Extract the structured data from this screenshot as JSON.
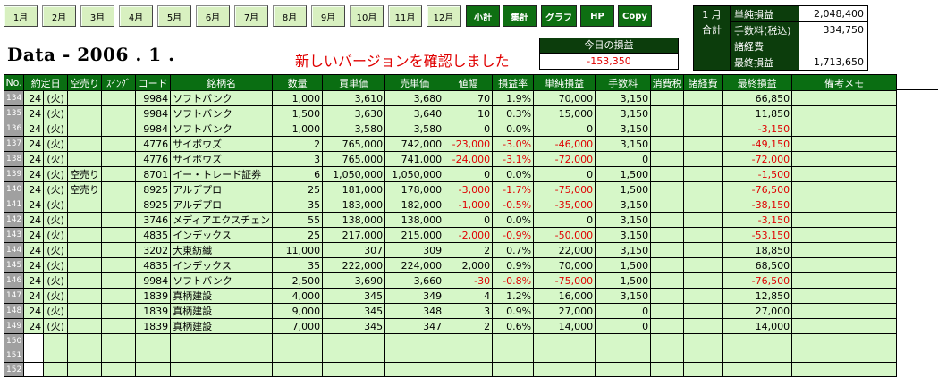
{
  "months": [
    "1月",
    "2月",
    "3月",
    "4月",
    "5月",
    "6月",
    "7月",
    "8月",
    "9月",
    "10月",
    "11月",
    "12月"
  ],
  "actions": [
    "小計",
    "集計",
    "グラフ",
    "HP",
    "Copy"
  ],
  "title": "Data - 2006 . 1 .",
  "notice": "新しいバージョンを確認しました",
  "today": {
    "label": "今日の損益",
    "value": "-153,350"
  },
  "summary": {
    "month": "1 月",
    "total": "合計",
    "rows": [
      {
        "label": "単純損益",
        "value": "2,048,400"
      },
      {
        "label": "手数料(税込)",
        "value": "334,750"
      },
      {
        "label": "諸経費",
        "value": ""
      },
      {
        "label": "最終損益",
        "value": "1,713,650"
      }
    ]
  },
  "columns": [
    "No.",
    "約定日",
    "空売り",
    "ｽｲﾝｸﾞ",
    "コード",
    "銘柄名",
    "数量",
    "買単価",
    "売単価",
    "値幅",
    "損益率",
    "単純損益",
    "手数料",
    "消費税",
    "諸経費",
    "最終損益",
    "備考メモ"
  ],
  "rows": [
    {
      "no": "134",
      "date": "24",
      "dow": "(火)",
      "short": "",
      "code": "9984",
      "name": "ソフトバンク",
      "qty": "1,000",
      "buy": "3,610",
      "sell": "3,680",
      "diff": "70",
      "rate": "1.9%",
      "pl": "70,000",
      "fee": "3,150",
      "final": "66,850"
    },
    {
      "no": "135",
      "date": "24",
      "dow": "(火)",
      "short": "",
      "code": "9984",
      "name": "ソフトバンク",
      "qty": "1,500",
      "buy": "3,630",
      "sell": "3,640",
      "diff": "10",
      "rate": "0.3%",
      "pl": "15,000",
      "fee": "3,150",
      "final": "11,850"
    },
    {
      "no": "136",
      "date": "24",
      "dow": "(火)",
      "short": "",
      "code": "9984",
      "name": "ソフトバンク",
      "qty": "1,000",
      "buy": "3,580",
      "sell": "3,580",
      "diff": "0",
      "rate": "0.0%",
      "pl": "0",
      "fee": "3,150",
      "final": "-3,150"
    },
    {
      "no": "137",
      "date": "24",
      "dow": "(火)",
      "short": "",
      "code": "4776",
      "name": "サイボウズ",
      "qty": "2",
      "buy": "765,000",
      "sell": "742,000",
      "diff": "-23,000",
      "rate": "-3.0%",
      "pl": "-46,000",
      "fee": "3,150",
      "final": "-49,150"
    },
    {
      "no": "138",
      "date": "24",
      "dow": "(火)",
      "short": "",
      "code": "4776",
      "name": "サイボウズ",
      "qty": "3",
      "buy": "765,000",
      "sell": "741,000",
      "diff": "-24,000",
      "rate": "-3.1%",
      "pl": "-72,000",
      "fee": "0",
      "final": "-72,000"
    },
    {
      "no": "139",
      "date": "24",
      "dow": "(火)",
      "short": "空売り",
      "code": "8701",
      "name": "イー・トレード証券",
      "qty": "6",
      "buy": "1,050,000",
      "sell": "1,050,000",
      "diff": "0",
      "rate": "0.0%",
      "pl": "0",
      "fee": "1,500",
      "final": "-1,500"
    },
    {
      "no": "140",
      "date": "24",
      "dow": "(火)",
      "short": "空売り",
      "code": "8925",
      "name": "アルデプロ",
      "qty": "25",
      "buy": "181,000",
      "sell": "178,000",
      "diff": "-3,000",
      "rate": "-1.7%",
      "pl": "-75,000",
      "fee": "1,500",
      "final": "-76,500"
    },
    {
      "no": "141",
      "date": "24",
      "dow": "(火)",
      "short": "",
      "code": "8925",
      "name": "アルデプロ",
      "qty": "35",
      "buy": "183,000",
      "sell": "182,000",
      "diff": "-1,000",
      "rate": "-0.5%",
      "pl": "-35,000",
      "fee": "3,150",
      "final": "-38,150"
    },
    {
      "no": "142",
      "date": "24",
      "dow": "(火)",
      "short": "",
      "code": "3746",
      "name": "メディアエクスチェン",
      "qty": "55",
      "buy": "138,000",
      "sell": "138,000",
      "diff": "0",
      "rate": "0.0%",
      "pl": "0",
      "fee": "3,150",
      "final": "-3,150"
    },
    {
      "no": "143",
      "date": "24",
      "dow": "(火)",
      "short": "",
      "code": "4835",
      "name": "インデックス",
      "qty": "25",
      "buy": "217,000",
      "sell": "215,000",
      "diff": "-2,000",
      "rate": "-0.9%",
      "pl": "-50,000",
      "fee": "3,150",
      "final": "-53,150"
    },
    {
      "no": "144",
      "date": "24",
      "dow": "(火)",
      "short": "",
      "code": "3202",
      "name": "大東紡織",
      "qty": "11,000",
      "buy": "307",
      "sell": "309",
      "diff": "2",
      "rate": "0.7%",
      "pl": "22,000",
      "fee": "3,150",
      "final": "18,850"
    },
    {
      "no": "145",
      "date": "24",
      "dow": "(火)",
      "short": "",
      "code": "4835",
      "name": "インデックス",
      "qty": "35",
      "buy": "222,000",
      "sell": "224,000",
      "diff": "2,000",
      "rate": "0.9%",
      "pl": "70,000",
      "fee": "1,500",
      "final": "68,500"
    },
    {
      "no": "146",
      "date": "24",
      "dow": "(火)",
      "short": "",
      "code": "9984",
      "name": "ソフトバンク",
      "qty": "2,500",
      "buy": "3,690",
      "sell": "3,660",
      "diff": "-30",
      "rate": "-0.8%",
      "pl": "-75,000",
      "fee": "1,500",
      "final": "-76,500"
    },
    {
      "no": "147",
      "date": "24",
      "dow": "(火)",
      "short": "",
      "code": "1839",
      "name": "真柄建設",
      "qty": "4,000",
      "buy": "345",
      "sell": "349",
      "diff": "4",
      "rate": "1.2%",
      "pl": "16,000",
      "fee": "3,150",
      "final": "12,850"
    },
    {
      "no": "148",
      "date": "24",
      "dow": "(火)",
      "short": "",
      "code": "1839",
      "name": "真柄建設",
      "qty": "9,000",
      "buy": "345",
      "sell": "348",
      "diff": "3",
      "rate": "0.9%",
      "pl": "27,000",
      "fee": "0",
      "final": "27,000"
    },
    {
      "no": "149",
      "date": "24",
      "dow": "(火)",
      "short": "",
      "code": "1839",
      "name": "真柄建設",
      "qty": "7,000",
      "buy": "345",
      "sell": "347",
      "diff": "2",
      "rate": "0.6%",
      "pl": "14,000",
      "fee": "0",
      "final": "14,000"
    }
  ],
  "empty_rows": [
    "150",
    "151",
    "152"
  ],
  "negative_color": "#e00000",
  "header_green": "#0a6e12"
}
